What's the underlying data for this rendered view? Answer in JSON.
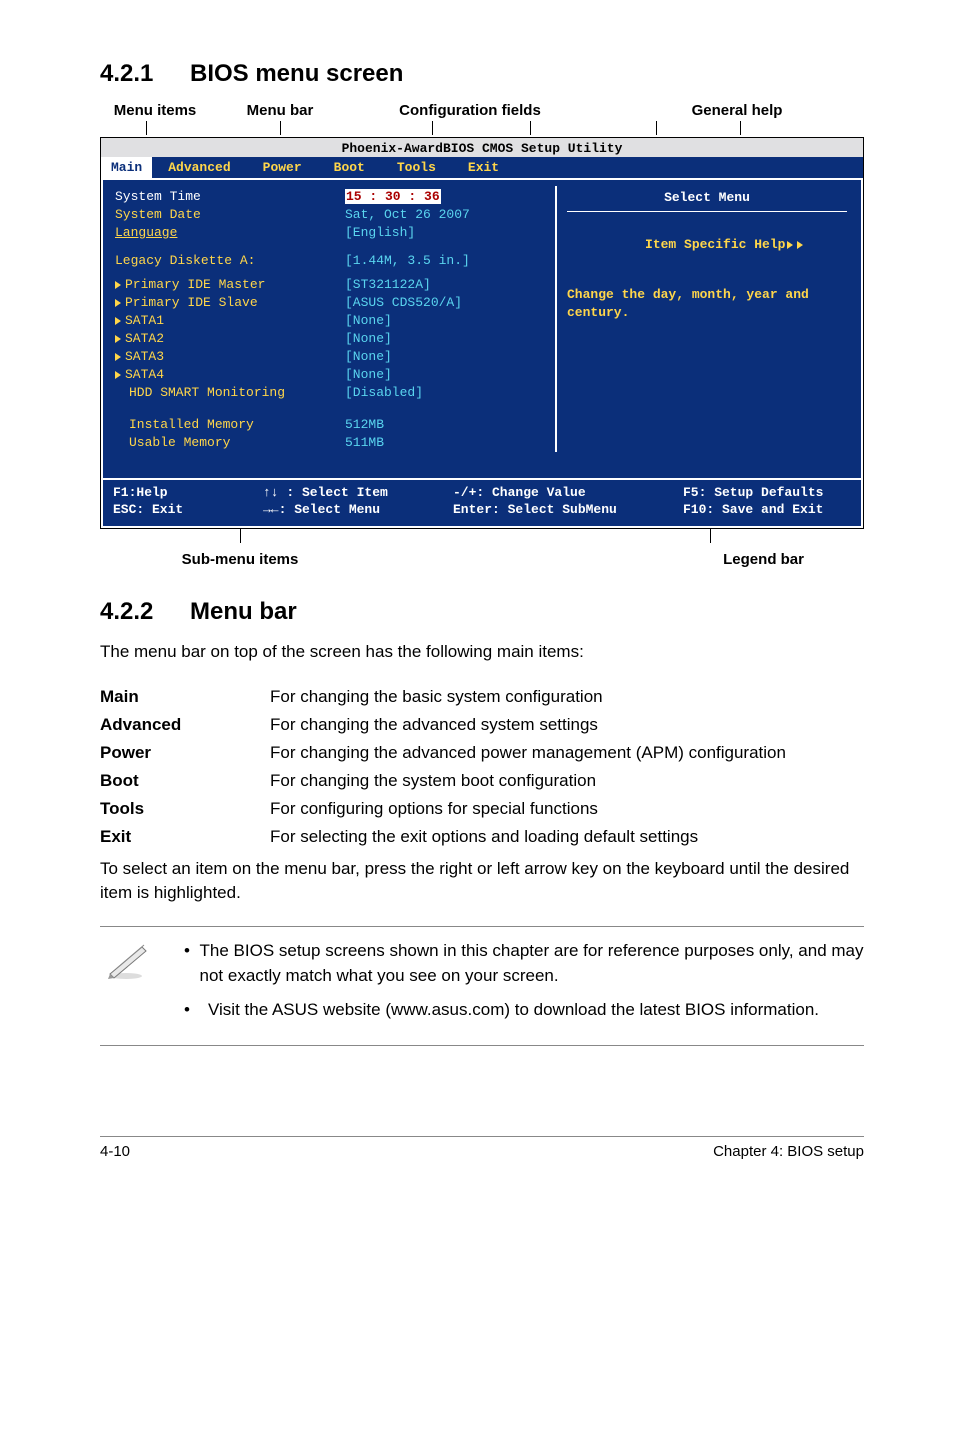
{
  "headings": {
    "h421_num": "4.2.1",
    "h421_title": "BIOS menu screen",
    "h422_num": "4.2.2",
    "h422_title": "Menu bar"
  },
  "labels": {
    "menu_items": "Menu items",
    "menu_bar": "Menu bar",
    "config_fields": "Configuration fields",
    "general_help": "General help",
    "sub_menu_items": "Sub-menu items",
    "legend_bar": "Legend bar"
  },
  "bios": {
    "title": "Phoenix-AwardBIOS CMOS Setup Utility",
    "menus": [
      "Main",
      "Advanced",
      "Power",
      "Boot",
      "Tools",
      "Exit"
    ],
    "left": {
      "system_time": "System Time",
      "system_date": "System Date",
      "language": "Language",
      "legacy": "Legacy Diskette A:",
      "pim": "Primary IDE Master",
      "pis": "Primary IDE Slave",
      "s1": "SATA1",
      "s2": "SATA2",
      "s3": "SATA3",
      "s4": "SATA4",
      "hdd": "HDD SMART Monitoring",
      "inst": "Installed Memory",
      "usab": "Usable Memory"
    },
    "mid": {
      "time": "15 : 30 : 36",
      "date": "Sat, Oct 26 2007",
      "lang": "[English]",
      "legacy": "[1.44M, 3.5 in.]",
      "pim": "[ST321122A]",
      "pis": "[ASUS CDS520/A]",
      "s1": "[None]",
      "s2": "[None]",
      "s3": "[None]",
      "s4": "[None]",
      "hdd": "[Disabled]",
      "inst": "512MB",
      "usab": "511MB"
    },
    "right": {
      "title": "Select Menu",
      "help_label": "Item Specific Help",
      "help_text": "Change the day, month, year and century."
    },
    "legend": {
      "l1a": "F1:Help",
      "l1b": "↑↓ : Select Item",
      "l1c": "-/+: Change Value",
      "l1d": "F5: Setup Defaults",
      "l2a": "ESC: Exit",
      "l2b": "→←: Select Menu",
      "l2c": "Enter: Select SubMenu",
      "l2d": "F10: Save and Exit"
    }
  },
  "section_422": {
    "intro": "The menu bar on top of the screen has the following main items:",
    "rows": [
      {
        "label": "Main",
        "desc": "For changing the basic system configuration"
      },
      {
        "label": "Advanced",
        "desc": "For changing the advanced system settings"
      },
      {
        "label": "Power",
        "desc": "For changing the advanced power management (APM) configuration"
      },
      {
        "label": "Boot",
        "desc": "For changing the system boot configuration"
      },
      {
        "label": "Tools",
        "desc": "For configuring options for special functions"
      },
      {
        "label": "Exit",
        "desc": "For selecting the exit options and loading default settings"
      }
    ],
    "tail": "To select an item on the menu bar, press the right or left arrow key on the keyboard until the desired item is highlighted."
  },
  "note": {
    "b1": "The BIOS setup screens shown in this chapter are for reference purposes only, and may not exactly match what you see on your screen.",
    "b2": "Visit the ASUS website (www.asus.com) to download the latest BIOS information."
  },
  "footer": {
    "page": "4-10",
    "chapter": "Chapter 4: BIOS setup"
  }
}
